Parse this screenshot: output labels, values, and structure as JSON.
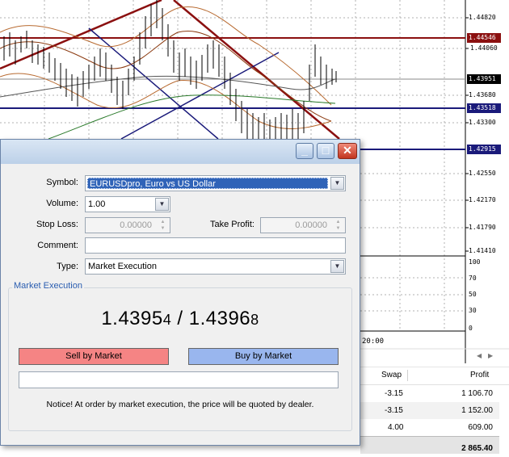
{
  "chart": {
    "price_scale": [
      "1.44820",
      "1.44060",
      "1.43680",
      "1.43300",
      "1.42550",
      "1.42170",
      "1.41790",
      "1.41410"
    ],
    "tagged_prices": {
      "red_level": "1.44546",
      "current": "1.43951",
      "blue_level_1": "1.43518",
      "blue_level_2": "1.42915"
    },
    "oscillator_scale": [
      "100",
      "70",
      "50",
      "30",
      "0"
    ],
    "time_label": "20:00",
    "colors": {
      "red_line": "#8b1010",
      "blue_line": "#1a1a7a",
      "candle": "#000000",
      "grid": "#a0a0a0"
    }
  },
  "terminal": {
    "columns": [
      "Swap",
      "Profit"
    ],
    "rows": [
      {
        "swap": "-3.15",
        "profit": "1 106.70"
      },
      {
        "swap": "-3.15",
        "profit": "1 152.00"
      },
      {
        "swap": "4.00",
        "profit": "609.00"
      }
    ],
    "total": "2 865.40"
  },
  "dialog": {
    "controls": {
      "minimize": "_",
      "maximize": "□",
      "close": "✕"
    },
    "symbol": {
      "label": "Symbol:",
      "value": "EURUSDpro, Euro vs US Dollar"
    },
    "volume": {
      "label": "Volume:",
      "value": "1.00"
    },
    "stop_loss": {
      "label": "Stop Loss:",
      "value": "0.00000"
    },
    "take_profit": {
      "label": "Take Profit:",
      "value": "0.00000"
    },
    "comment": {
      "label": "Comment:",
      "value": ""
    },
    "type": {
      "label": "Type:",
      "value": "Market Execution"
    },
    "group_title": "Market Execution",
    "quote": {
      "bid_main": "1.4395",
      "bid_small": "4",
      "separator": " / ",
      "ask_main": "1.4396",
      "ask_small": "8"
    },
    "sell_label": "Sell by Market",
    "buy_label": "Buy by Market",
    "notice": "Notice! At order by market execution, the price will be quoted by dealer.",
    "colors": {
      "sell": "#f58484",
      "buy": "#99b6ee",
      "group_title": "#2a5db0"
    }
  }
}
